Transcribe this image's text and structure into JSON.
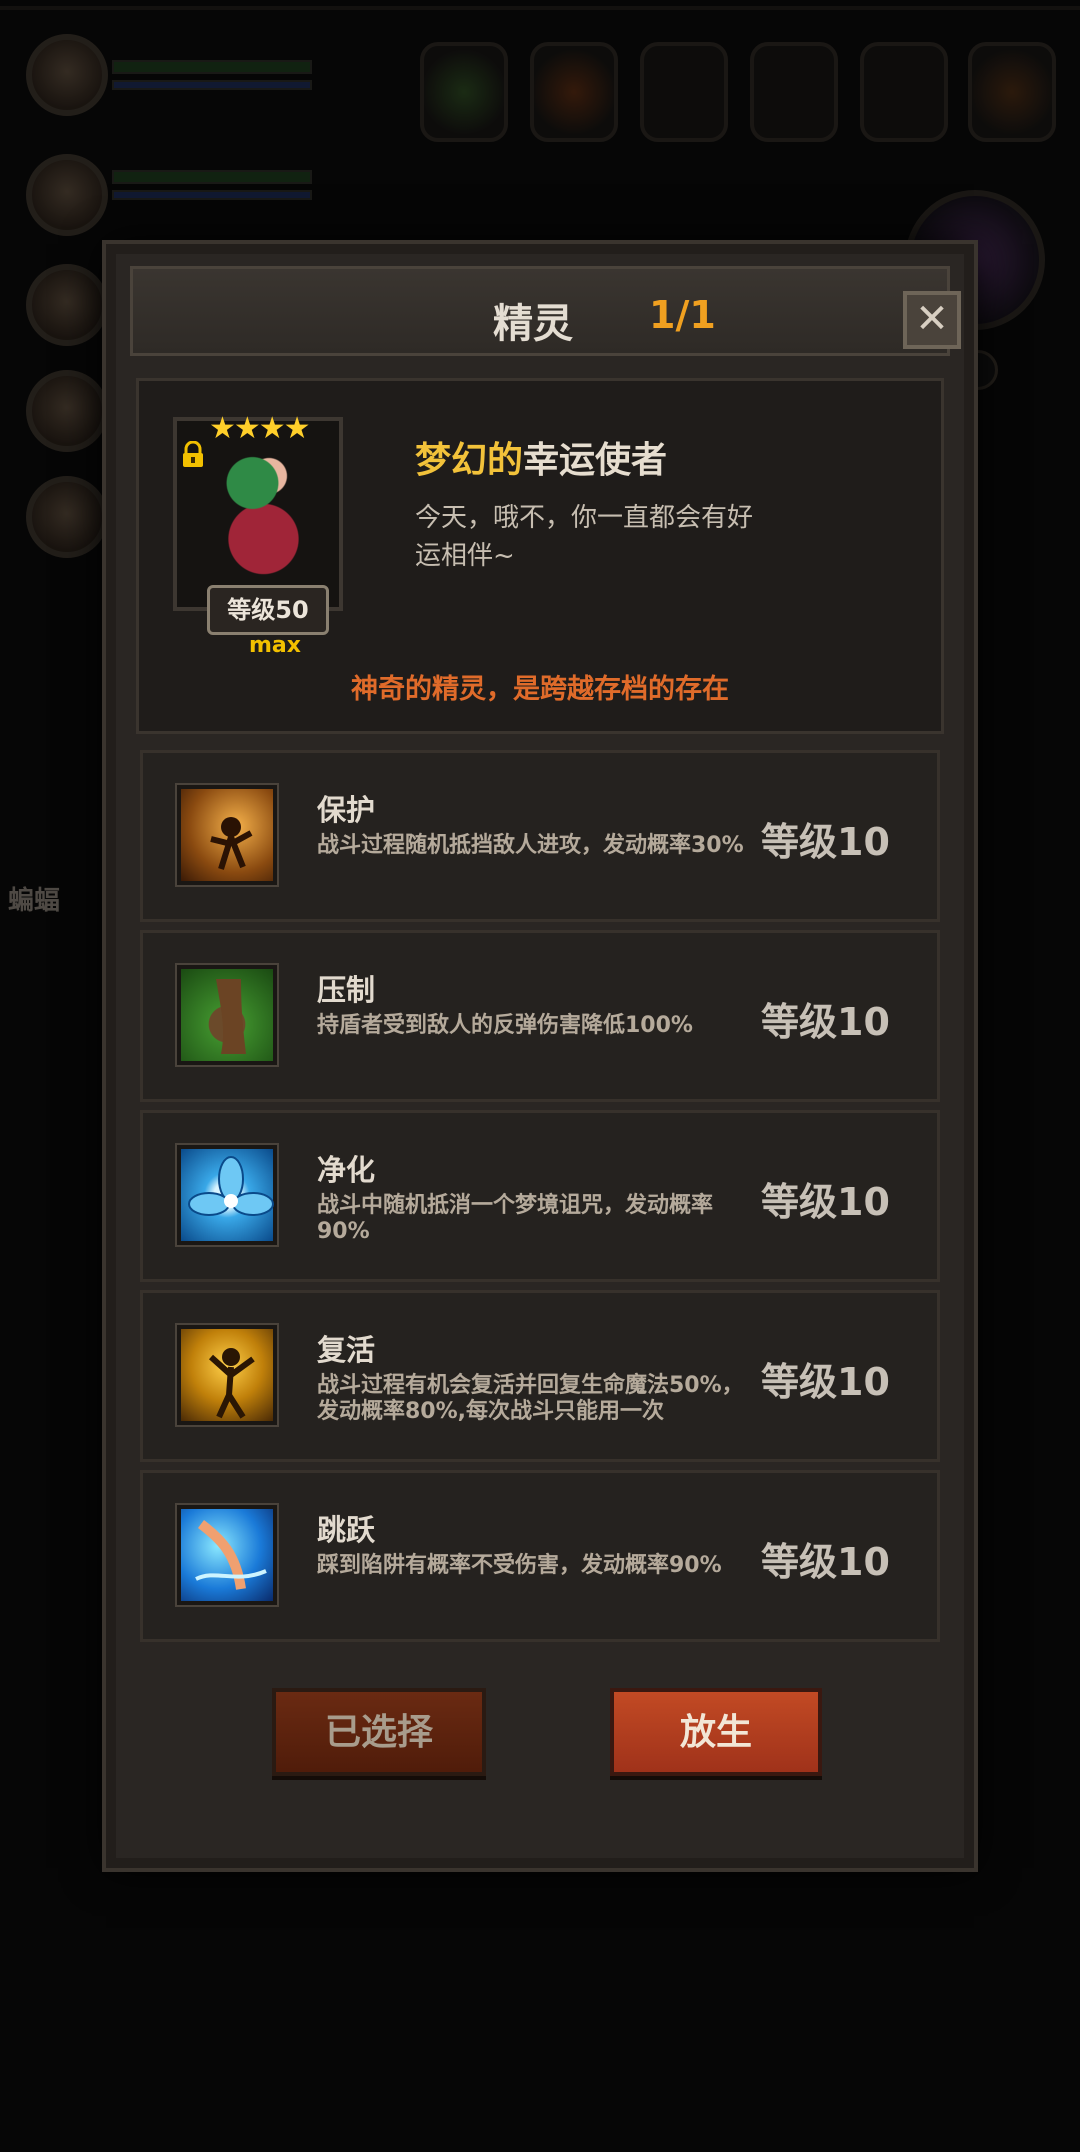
{
  "background": {
    "side_label": "蝙蝠"
  },
  "dialog": {
    "title": "精灵",
    "count": "1/1",
    "close_label": "✕"
  },
  "pet": {
    "stars": "★★★★",
    "level_label": "等级50",
    "max_label": "max",
    "name_part1": "梦幻的",
    "name_part2": "幸运使者",
    "description": "今天，哦不，你一直都会有好运相伴~",
    "note": "神奇的精灵，是跨越存档的存在"
  },
  "skills": [
    {
      "name": "保护",
      "description": "战斗过程随机抵挡敌人进攻，发动概率30%",
      "level": "等级10",
      "icon": "protection-icon"
    },
    {
      "name": "压制",
      "description": "持盾者受到敌人的反弹伤害降低100%",
      "level": "等级10",
      "icon": "suppress-icon"
    },
    {
      "name": "净化",
      "description": "战斗中随机抵消一个梦境诅咒，发动概率90%",
      "level": "等级10",
      "icon": "purify-icon"
    },
    {
      "name": "复活",
      "description": "战斗过程有机会复活并回复生命魔法50%，发动概率80%,每次战斗只能用一次",
      "level": "等级10",
      "icon": "revive-icon"
    },
    {
      "name": "跳跃",
      "description": "踩到陷阱有概率不受伤害，发动概率90%",
      "level": "等级10",
      "icon": "jump-icon"
    }
  ],
  "buttons": {
    "selected": "已选择",
    "release": "放生"
  },
  "colors": {
    "accent_gold": "#f2c23a",
    "count_orange": "#f0a020",
    "note_orange": "#e06b2a",
    "release_red": "#c24a24"
  }
}
